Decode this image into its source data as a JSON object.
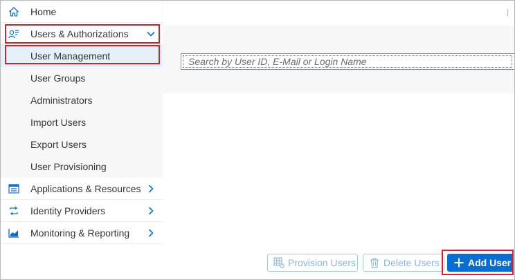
{
  "sidebar": {
    "items": [
      {
        "label": "Home",
        "icon": "home-icon"
      },
      {
        "label": "Users & Authorizations",
        "icon": "users-authorizations-icon",
        "expanded": true
      },
      {
        "label": "User Management",
        "selected": true
      },
      {
        "label": "User Groups"
      },
      {
        "label": "Administrators"
      },
      {
        "label": "Import Users"
      },
      {
        "label": "Export Users"
      },
      {
        "label": "User Provisioning"
      },
      {
        "label": "Applications & Resources",
        "icon": "applications-icon"
      },
      {
        "label": "Identity Providers",
        "icon": "identity-providers-icon"
      },
      {
        "label": "Monitoring & Reporting",
        "icon": "monitoring-icon"
      }
    ]
  },
  "search": {
    "placeholder": "Search by User ID, E-Mail or Login Name",
    "value": ""
  },
  "footer": {
    "provision_label": "Provision Users",
    "delete_label": "Delete Users",
    "add_label": "Add User"
  },
  "colors": {
    "accent": "#0a6ed1",
    "highlight": "#d21f33",
    "icon": "#0a6ed1",
    "selected_bg": "#e5f0fa"
  }
}
